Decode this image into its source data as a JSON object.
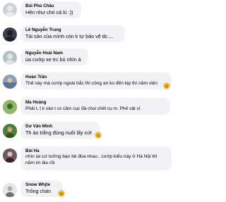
{
  "comments": [
    {
      "name": "Bùi Phú Châu",
      "text": "Hên như chó cá lù :))",
      "avatar_color": "#c9d2d8"
    },
    {
      "name": "Lê Nguyễn Trung",
      "text": "Tài sản của mình còn k tự bảo vệ dc....",
      "avatar_color": "#3b3f4a"
    },
    {
      "name": "Nguyễn Hoài Nam",
      "text": "ủa cướp xe trc bủ nhìn á",
      "avatar_color": "#b7bfc6"
    },
    {
      "name": "Hoàn Trần",
      "text": "Thế này mà cướp ngoài bắc thì công an ko đến kịp thì năm viện",
      "avatar_color": "#8aa0b8",
      "reaction": "haha-icon"
    },
    {
      "name": "Ma Hoàng",
      "text": "Phải t, t k vào t cx cầm cục đá chọi chết cụ m. Phế vật vl.",
      "avatar_color": "#6f9b54"
    },
    {
      "name": "Dư Văn Minh",
      "text": "Th ảo trắng đúng nuôi lấy cứt",
      "avatar_color": "#4f7d3c",
      "reaction": "haha-icon"
    },
    {
      "name": "Bùi Hà",
      "text": "nhìn lại cứ tưởng bạn bè đùa nhau , cướp kiểu này ở Hà Nội thì năm im lâu rồi",
      "avatar_color": "#5a4a52"
    },
    {
      "name": "Snow Whjte",
      "text": "Trông chán",
      "avatar_color": "#c8ccd0",
      "reaction": "haha-icon"
    }
  ],
  "colors": {
    "bubble": "#f0f2f5",
    "reaction": "#f7b928"
  }
}
